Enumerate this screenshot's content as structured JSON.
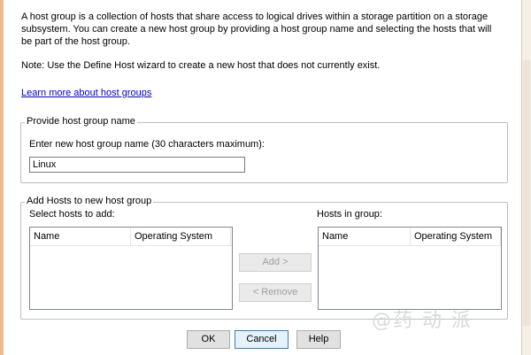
{
  "intro": {
    "description": "A host group is a collection of hosts that share access to logical drives within a storage partition on a storage subsystem. You can create a new host group by providing a host group name and selecting the hosts that will be part of the host group.",
    "note": "Note: Use the Define Host wizard to create a new host that does not currently exist.",
    "learn_more_link": "Learn more about host groups"
  },
  "name_group": {
    "legend": "Provide host group name",
    "field_label": "Enter new host group name (30 characters maximum):",
    "field_value": "Linux"
  },
  "hosts_group": {
    "legend": "Add Hosts to new host group",
    "select_label": "Select hosts to add:",
    "in_group_label": "Hosts in group:",
    "columns": [
      "Name",
      "Operating System"
    ],
    "available_hosts": [],
    "hosts_in_group": [],
    "add_button": "Add >",
    "remove_button": "< Remove"
  },
  "footer": {
    "ok": "OK",
    "cancel": "Cancel",
    "help": "Help"
  },
  "watermark": "@药 动 派"
}
